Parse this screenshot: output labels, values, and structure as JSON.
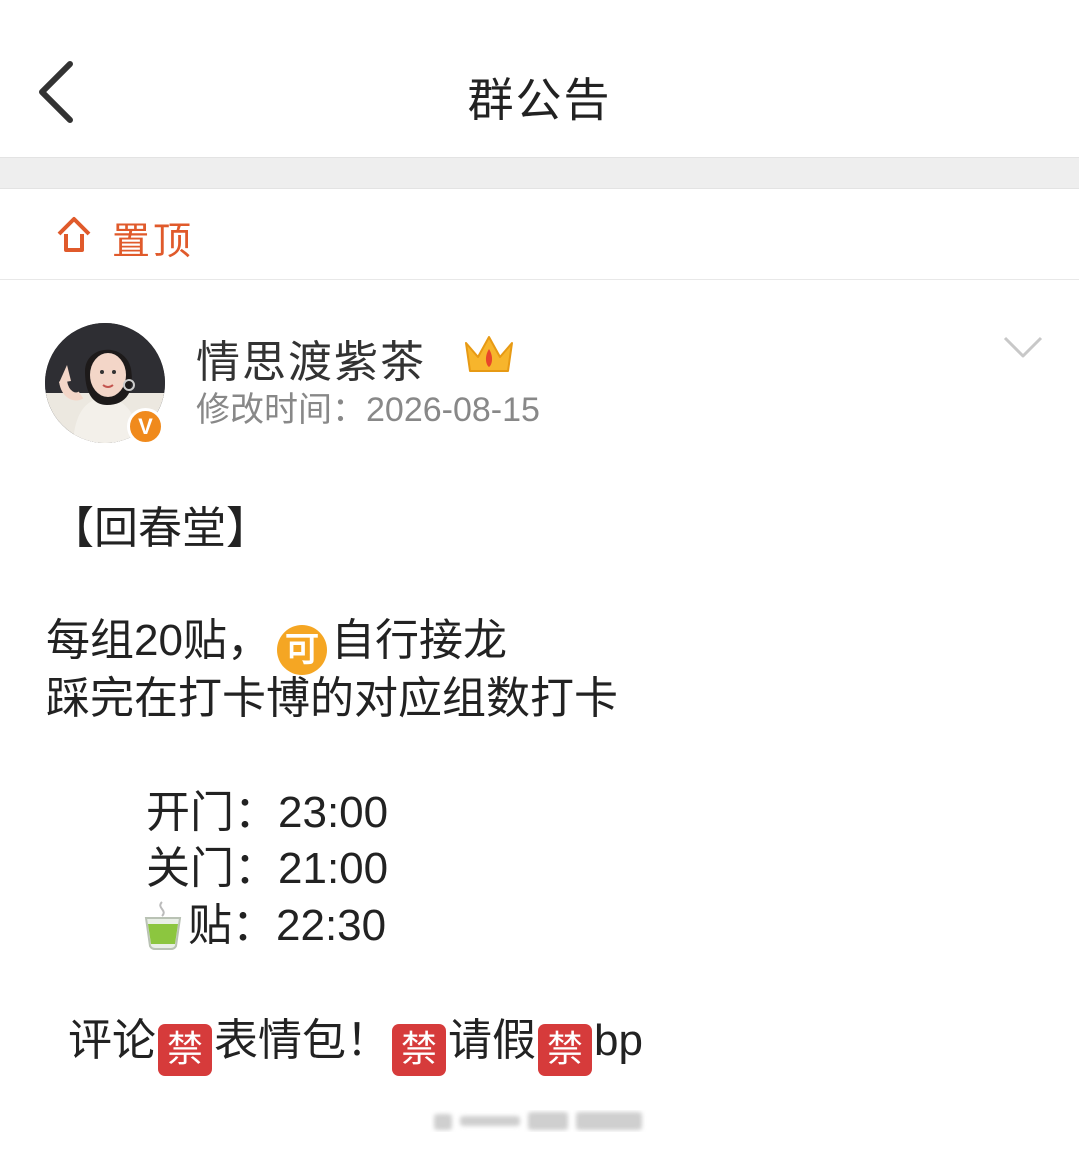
{
  "header": {
    "title": "群公告",
    "back_icon": "chevron-left-icon"
  },
  "pin": {
    "label": "置顶",
    "icon": "pin-top-icon",
    "color": "#e05a2b"
  },
  "post": {
    "author": "情思渡紫茶",
    "badge_icons": [
      "crown-icon",
      "verified-v-icon"
    ],
    "modified_label": "修改时间：",
    "modified_date": "2026-08-15",
    "expand_icon": "chevron-down-icon",
    "lines": {
      "l1": "【回春堂】",
      "l2a": "每组20贴，",
      "l2_emoji": "可",
      "l2b": "自行接龙",
      "l3": "踩完在打卡博的对应组数打卡",
      "l4_label": "开门：",
      "l4_time": "23:00",
      "l5_label": "关门：",
      "l5_time": "21:00",
      "l6_label": "贴：",
      "l6_time": "22:30",
      "l7a": "评论",
      "l7_ban": "禁",
      "l7b": "表情包！",
      "l7c": "请假",
      "l7d": "bp"
    }
  },
  "colors": {
    "ban_badge": "#d63b3b",
    "ke_badge": "#f5a623",
    "verified": "#f08a1c"
  }
}
